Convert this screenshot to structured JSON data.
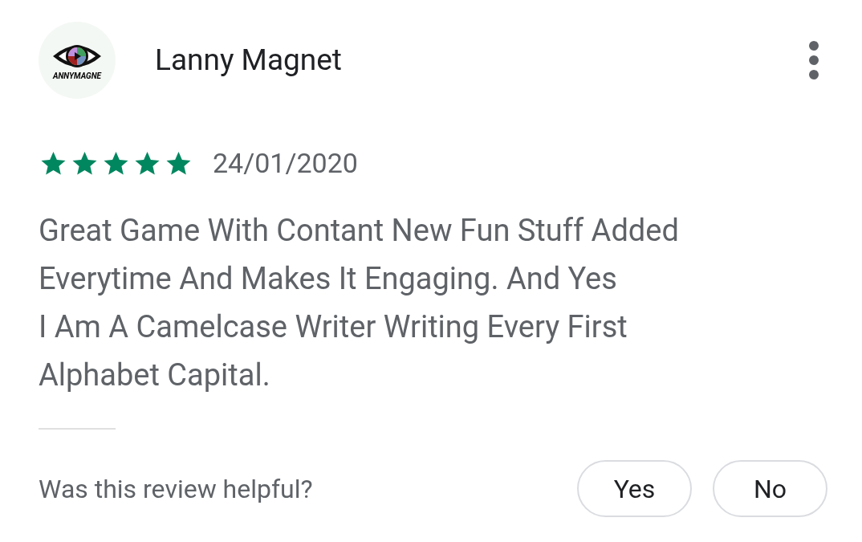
{
  "reviewer": {
    "name": "Lanny Magnet",
    "avatar_text": "ANNYMAGNE"
  },
  "review": {
    "stars": 5,
    "date": "24/01/2020",
    "text": "Great Game With Contant New Fun Stuff Added Everytime And Makes It Engaging. And Yes\nI Am A Camelcase Writer Writing Every First Alphabet Capital."
  },
  "helpful": {
    "question": "Was this review helpful?",
    "buttons": [
      "Yes",
      "No"
    ]
  }
}
